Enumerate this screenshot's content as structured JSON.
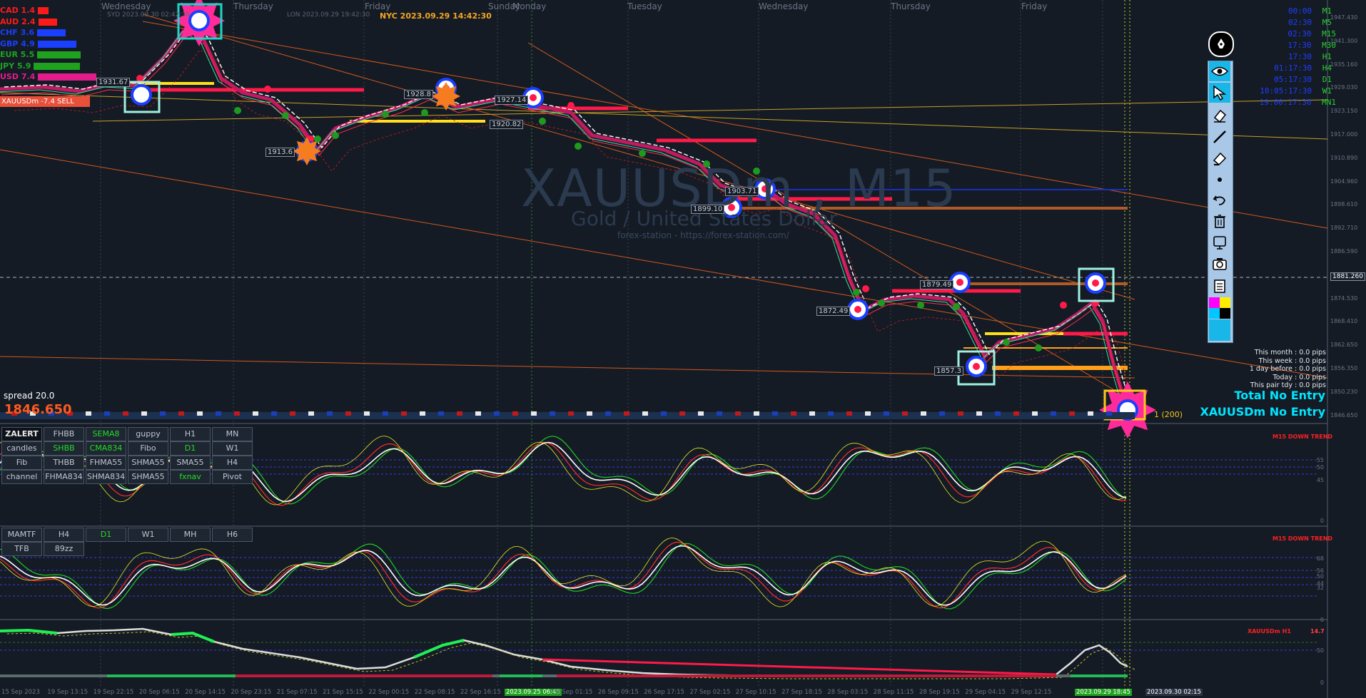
{
  "header": {
    "days": [
      "Wednesday",
      "Thursday",
      "Friday",
      "Sunday",
      "Monday",
      "Tuesday",
      "Wednesday",
      "Thursday",
      "Friday"
    ],
    "sessions": [
      "SYD 2023.09.30 02:42:30",
      "LON 2023.09.29 19:42:30"
    ],
    "nyc_time": "NYC 2023.09.29 14:42:30"
  },
  "watermark": {
    "symbol": "XAUUSDm , M15",
    "name": "Gold / United States Dollar",
    "site": "forex-station - https://forex-station.com/"
  },
  "currency_strength": [
    {
      "code": "CAD",
      "value": "1.4",
      "color": "#ff1a1a"
    },
    {
      "code": "AUD",
      "value": "2.4",
      "color": "#ff1a1a"
    },
    {
      "code": "CHF",
      "value": "3.6",
      "color": "#1a3fff"
    },
    {
      "code": "GBP",
      "value": "4.9",
      "color": "#1a3fff"
    },
    {
      "code": "EUR",
      "value": "5.5",
      "color": "#1fa31f"
    },
    {
      "code": "JPY",
      "value": "5.9",
      "color": "#1fa31f"
    },
    {
      "code": "USD",
      "value": "7.4",
      "color": "#e21c8a"
    }
  ],
  "signal_label": "XAUUSDm -7.4 SELL",
  "spread": "spread 20.0",
  "big_price": "1846.650",
  "timeframes": [
    {
      "time": "00:00",
      "code": "M1"
    },
    {
      "time": "02:30",
      "code": "M5"
    },
    {
      "time": "02:30",
      "code": "M15"
    },
    {
      "time": "17:30",
      "code": "M30"
    },
    {
      "time": "17:30",
      "code": "H1"
    },
    {
      "time": "01:17:30",
      "code": "H4"
    },
    {
      "time": "05:17:30",
      "code": "D1"
    },
    {
      "time": "10:05:17:30",
      "code": "W1"
    },
    {
      "time": "19:00:17:30",
      "code": "MN1"
    }
  ],
  "pips": [
    "This month : 0.0 pips",
    "This week : 0.0 pips",
    "1 day before : 0.0 pips",
    "Today : 0.0 pips",
    "This pair tdy : 0.0 pips"
  ],
  "total_no_entry": "Total No Entry",
  "symbol_no_entry": "XAUUSDm No Entry",
  "indicator_grid": [
    [
      "ZALERT",
      "FHBB",
      "SEMA8",
      "guppy",
      "H1",
      "MN"
    ],
    [
      "candles",
      "SHBB",
      "CMA834",
      "Fibo",
      "D1",
      "W1"
    ],
    [
      "Fib",
      "THBB",
      "FHMA55",
      "SHMA55",
      "SMA55",
      "H4"
    ],
    [
      "channel",
      "FHMA834",
      "SHMA834",
      "SHMA55",
      "fxnav",
      "Pivot"
    ]
  ],
  "mamtf_grid": [
    [
      "MAMTF",
      "H4",
      "D1",
      "W1",
      "MH",
      "H6"
    ],
    [
      "TFB",
      "89zz"
    ]
  ],
  "price_axis": [
    "1947.430",
    "1941.300",
    "1935.160",
    "1929.030",
    "1923.150",
    "1917.000",
    "1910.890",
    "1904.960",
    "1898.610",
    "1892.710",
    "1886.590",
    "1881.260",
    "1874.530",
    "1868.410",
    "1862.650",
    "1856.350",
    "1850.230",
    "1846.650"
  ],
  "current_price": "1881.260",
  "level_labels": [
    {
      "text": "1931.67",
      "cls": "a"
    },
    {
      "text": "1928.8",
      "cls": "b"
    },
    {
      "text": "1927.14",
      "cls": "c"
    },
    {
      "text": "1920.82",
      "cls": "d"
    },
    {
      "text": "1913.6",
      "cls": "e"
    },
    {
      "text": "1903.71",
      "cls": "f"
    },
    {
      "text": "1899.10",
      "cls": "g"
    },
    {
      "text": "1879.49",
      "cls": "h"
    },
    {
      "text": "1872.49",
      "cls": "i"
    },
    {
      "text": "1857.3",
      "cls": "j"
    }
  ],
  "bottom_times": [
    "15 Sep 2023",
    "19 Sep 13:15",
    "19 Sep 22:15",
    "20 Sep 06:15",
    "20 Sep 14:15",
    "20 Sep 23:15",
    "21 Sep 07:15",
    "21 Sep 15:15",
    "22 Sep 00:15",
    "22 Sep 08:15",
    "22 Sep 16:15",
    "2023.09.25 06:45",
    "26 Sep 01:15",
    "26 Sep 09:15",
    "26 Sep 17:15",
    "27 Sep 02:15",
    "27 Sep 10:15",
    "27 Sep 18:15",
    "28 Sep 03:15",
    "28 Sep 11:15",
    "28 Sep 19:15",
    "29 Sep 04:15",
    "29 Sep 12:15",
    "2023.09.29 18:45",
    "2023.09.30 02:15"
  ],
  "subpanel_labels": {
    "trend1": "M15 DOWN TREND",
    "trend2": "M15 DOWN TREND",
    "h1": "XAUUSDm H1",
    "h1val": "14.7"
  },
  "sub_levels_1": [
    "55",
    "50",
    "45",
    "0"
  ],
  "sub_levels_2": [
    "68",
    "56",
    "50",
    "44",
    "32",
    "0"
  ],
  "sub_levels_3": [
    "50",
    "0"
  ],
  "ma_tag": "1 (200)",
  "colors": {
    "bg": "#141b25",
    "bull": "#22dd22",
    "bear": "#ff2b4a",
    "accent": "#00e5ff"
  }
}
